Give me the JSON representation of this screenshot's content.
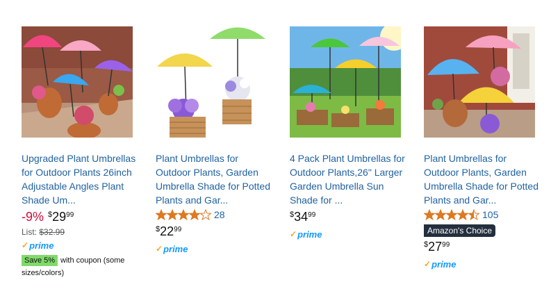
{
  "products": [
    {
      "title": "Upgraded Plant Umbrellas for Outdoor Plants 26inch Adjustable Angles Plant Shade Um...",
      "discount": "-9%",
      "price": {
        "symbol": "$",
        "whole": "29",
        "fraction": "99"
      },
      "list_label": "List:",
      "list_price": "$32.99",
      "prime_check": "✓",
      "prime_word": "prime",
      "coupon_badge": "Save 5%",
      "coupon_text": "with coupon (some sizes/colors)"
    },
    {
      "title": "Plant Umbrellas for Outdoor Plants, Garden Umbrella Shade for Potted Plants and Gar...",
      "rating": 4,
      "rating_count": "28",
      "price": {
        "symbol": "$",
        "whole": "22",
        "fraction": "99"
      },
      "prime_check": "✓",
      "prime_word": "prime"
    },
    {
      "title": "4 Pack Plant Umbrellas for Outdoor Plants,26\" Larger Garden Umbrella Sun Shade for ...",
      "price": {
        "symbol": "$",
        "whole": "34",
        "fraction": "99"
      },
      "prime_check": "✓",
      "prime_word": "prime"
    },
    {
      "title": "Plant Umbrellas for Outdoor Plants, Garden Umbrella Shade for Potted Plants and Gar...",
      "rating": 4.5,
      "rating_count": "105",
      "badge": "Amazon's Choice",
      "price": {
        "symbol": "$",
        "whole": "27",
        "fraction": "99"
      },
      "prime_check": "✓",
      "prime_word": "prime"
    }
  ],
  "colors": {
    "link": "#2162a1",
    "discount": "#cc0c39",
    "star": "#de7921",
    "prime": "#1399ff",
    "coupon": "#7fda69"
  }
}
